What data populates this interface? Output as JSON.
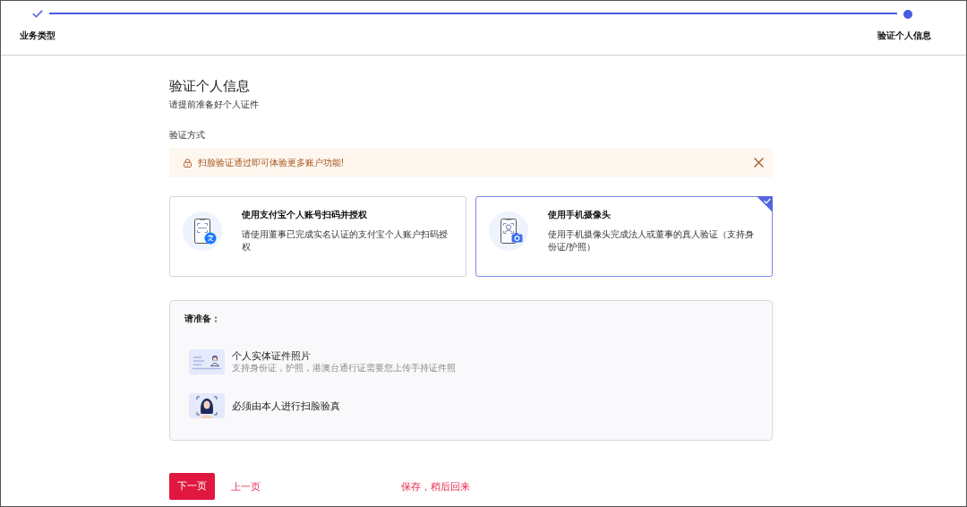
{
  "stepper": {
    "steps": [
      {
        "label": "业务类型",
        "completed": true
      },
      {
        "label": "验证个人信息",
        "completed": false
      }
    ]
  },
  "page": {
    "title": "验证个人信息",
    "subtitle": "请提前准备好个人证件"
  },
  "method_section": {
    "label": "验证方式",
    "alert": {
      "text": "扫脸验证通过即可体验更多账户功能!",
      "dismissible": true
    }
  },
  "options": [
    {
      "kind": "alipay",
      "title": "使用支付宝个人账号扫码并授权",
      "description": "请使用董事已完成实名认证的支付宝个人账户扫码授权",
      "selected": false
    },
    {
      "kind": "camera",
      "title": "使用手机摄像头",
      "description": "使用手机摄像头完成法人或董事的真人验证（支持身份证/护照）",
      "selected": true
    }
  ],
  "prepare": {
    "heading": "请准备：",
    "items": [
      {
        "kind": "id_card",
        "title": "个人实体证件照片",
        "description": "支持身份证，护照，港澳台通行证需要您上传手持证件照"
      },
      {
        "kind": "face",
        "title": "必须由本人进行扫脸验真"
      }
    ]
  },
  "actions": {
    "next": "下一页",
    "back": "上一页",
    "save": "保存，稍后回来"
  }
}
